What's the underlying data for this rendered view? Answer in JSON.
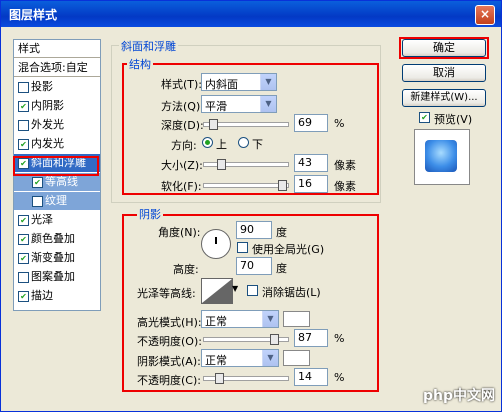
{
  "window": {
    "title": "图层样式",
    "close": "×"
  },
  "left_list": {
    "header": "样式",
    "blend": "混合选项:自定",
    "items": [
      {
        "label": "投影",
        "checked": false
      },
      {
        "label": "内阴影",
        "checked": true
      },
      {
        "label": "外发光",
        "checked": false
      },
      {
        "label": "内发光",
        "checked": true
      },
      {
        "label": "斜面和浮雕",
        "checked": true
      },
      {
        "label": "等高线",
        "checked": true
      },
      {
        "label": "纹理",
        "checked": false
      },
      {
        "label": "光泽",
        "checked": true
      },
      {
        "label": "颜色叠加",
        "checked": true
      },
      {
        "label": "渐变叠加",
        "checked": true
      },
      {
        "label": "图案叠加",
        "checked": false
      },
      {
        "label": "描边",
        "checked": true
      }
    ]
  },
  "bevel": {
    "group_title": "斜面和浮雕",
    "structure_title": "结构",
    "style_label": "样式(T):",
    "style_value": "内斜面",
    "method_label": "方法(Q):",
    "method_value": "平滑",
    "depth_label": "深度(D):",
    "depth_value": "69",
    "depth_unit": "%",
    "direction_label": "方向:",
    "dir_up": "上",
    "dir_down": "下",
    "size_label": "大小(Z):",
    "size_value": "43",
    "size_unit": "像素",
    "soften_label": "软化(F):",
    "soften_value": "16",
    "soften_unit": "像素",
    "depth_level": 0.069,
    "size_level": 0.17,
    "soften_level": 0.98
  },
  "shading": {
    "title": "阴影",
    "angle_label": "角度(N):",
    "angle_value": "90",
    "angle_unit": "度",
    "global_light": "使用全局光(G)",
    "altitude_label": "高度:",
    "altitude_value": "70",
    "altitude_unit": "度",
    "gloss_label": "光泽等高线:",
    "antialias": "消除锯齿(L)",
    "highlight_label": "高光模式(H):",
    "highlight_value": "正常",
    "opacity1_label": "不透明度(O):",
    "opacity1_value": "87",
    "opacity1_unit": "%",
    "shadow_label": "阴影模式(A):",
    "shadow_value": "正常",
    "opacity2_label": "不透明度(C):",
    "opacity2_value": "14",
    "opacity2_unit": "%",
    "opacity1_level": 0.87,
    "opacity2_level": 0.14
  },
  "buttons": {
    "ok": "确定",
    "cancel": "取消",
    "new_style": "新建样式(W)...",
    "preview": "预览(V)"
  },
  "watermark": "php中文网"
}
